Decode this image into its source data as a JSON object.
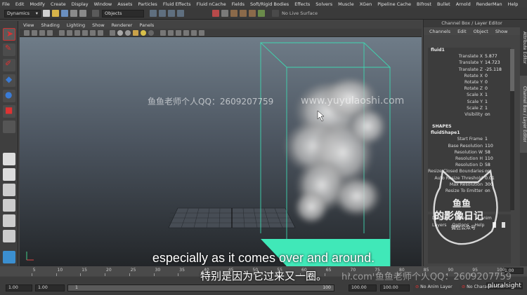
{
  "menubar": [
    "File",
    "Edit",
    "Modify",
    "Create",
    "Display",
    "Window",
    "Assets",
    "Particles",
    "Fluid Effects",
    "Fluid nCache",
    "Fields",
    "Soft/Rigid Bodies",
    "Effects",
    "Solvers",
    "Muscle",
    "XGen",
    "Pipeline Cache",
    "Bifrost",
    "Bullet",
    "Arnold",
    "RenderMan",
    "Help"
  ],
  "statusline": {
    "menuset": "Dynamics",
    "selection_mode": "Objects",
    "live_surface": "No Live Surface"
  },
  "viewport_menu": [
    "View",
    "Shading",
    "Lighting",
    "Show",
    "Renderer",
    "Panels"
  ],
  "channel_box": {
    "title": "Channel Box / Layer Editor",
    "menu": [
      "Channels",
      "Edit",
      "Object",
      "Show"
    ],
    "object_name": "fluid1",
    "attributes": [
      {
        "label": "Translate X",
        "value": "5.877"
      },
      {
        "label": "Translate Y",
        "value": "14.723"
      },
      {
        "label": "Translate Z",
        "value": "-25.118"
      },
      {
        "label": "Rotate X",
        "value": "0"
      },
      {
        "label": "Rotate Y",
        "value": "0"
      },
      {
        "label": "Rotate Z",
        "value": "0"
      },
      {
        "label": "Scale X",
        "value": "1"
      },
      {
        "label": "Scale Y",
        "value": "1"
      },
      {
        "label": "Scale Z",
        "value": "1"
      },
      {
        "label": "Visibility",
        "value": "on"
      }
    ],
    "shapes_header": "SHAPES",
    "shape_name": "fluidShape1",
    "shape_attributes": [
      {
        "label": "Start Frame",
        "value": "1"
      },
      {
        "label": "Base Resolution",
        "value": "110"
      },
      {
        "label": "Resolution W",
        "value": "58"
      },
      {
        "label": "Resolution H",
        "value": "110"
      },
      {
        "label": "Resolution D",
        "value": "58"
      },
      {
        "label": "Resize Closed Boundaries",
        "value": "on"
      },
      {
        "label": "Auto Resize Threshold",
        "value": "0.01"
      },
      {
        "label": "Max Resolution",
        "value": "300"
      },
      {
        "label": "Resize To Emitter",
        "value": "on"
      }
    ]
  },
  "layer_editor": {
    "tabs": [
      "Display",
      "Render",
      "Anim"
    ],
    "menu": [
      "Layers",
      "Options",
      "Help"
    ]
  },
  "side_tabs": [
    "Attribute Editor",
    "Channel Box / Layer Editor"
  ],
  "timeline": {
    "ticks": [
      "5",
      "10",
      "15",
      "20",
      "25",
      "30",
      "35",
      "40",
      "45",
      "50",
      "55",
      "60",
      "65",
      "70",
      "75",
      "80",
      "85",
      "90",
      "95",
      "100"
    ],
    "current_frame": "1.00"
  },
  "range": {
    "start": "1.00",
    "playback_start": "1.00",
    "slider_value": "1",
    "slider_end": "100",
    "playback_end": "100.00",
    "end": "100.00",
    "anim_layer": "No Anim Layer",
    "character_set": "No Character Set"
  },
  "subtitles": {
    "english": "especially as it comes over and around.",
    "chinese": "特别是因为它过来又一圈。"
  },
  "watermarks": {
    "qq": "鱼鱼老师个人QQ：2609207759",
    "site": "www.yuyulaoshi.com",
    "bottom": "hi.com  鱼鱼老师个人QQ：2609207759",
    "brand": "pluralsight"
  },
  "stamp": {
    "line1": "鱼鱼",
    "line2": "的影像日记",
    "line3": "微信公众号"
  },
  "colors": {
    "bounding_box": "#3fd6b0",
    "ground_plane": "#40e8b8"
  }
}
